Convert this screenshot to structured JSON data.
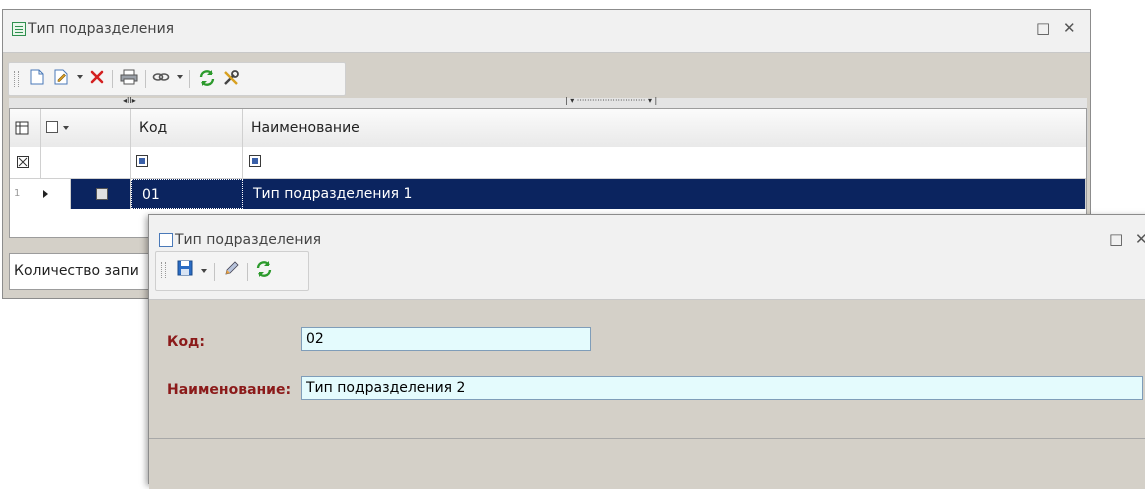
{
  "list_window": {
    "title": "Тип подразделения",
    "toolbar": {
      "icons": [
        "new-document-icon",
        "edit-icon",
        "dropdown-arrow",
        "delete-icon",
        "print-icon",
        "link-icon",
        "dropdown-arrow",
        "refresh-icon",
        "tools-icon"
      ]
    },
    "grid": {
      "columns": [
        "Код",
        "Наименование"
      ],
      "rows": [
        {
          "num": "1",
          "code": "01",
          "name": "Тип подразделения 1",
          "selected": true
        }
      ]
    },
    "status": "Количество запи"
  },
  "edit_window": {
    "title": "Тип подразделения",
    "toolbar": {
      "icons": [
        "save-icon",
        "dropdown-arrow",
        "pencil-icon",
        "refresh-icon"
      ]
    },
    "fields": {
      "code": {
        "label": "Код:",
        "value": "02"
      },
      "name": {
        "label": "Наименование:",
        "value": "Тип подразделения 2"
      }
    }
  },
  "window_controls": [
    "□",
    "✕"
  ],
  "colors": {
    "selection": "#0b245f",
    "label": "#8b1a1a",
    "input_bg": "#e4fbfd",
    "panel_bg": "#d4d0c8"
  }
}
